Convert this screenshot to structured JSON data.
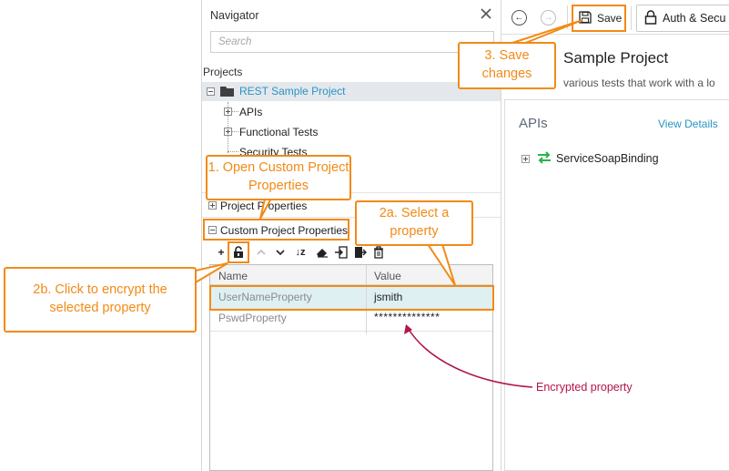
{
  "navigator": {
    "title": "Navigator",
    "search_placeholder": "Search",
    "projects_label": "Projects",
    "project_name": "REST Sample Project",
    "tree_items": [
      "APIs",
      "Functional Tests",
      "Security Tests"
    ],
    "project_properties_label": "Project Properties",
    "custom_properties_label": "Custom Project Properties"
  },
  "properties_table": {
    "columns": [
      "Name",
      "Value"
    ],
    "rows": [
      {
        "name": "UserNameProperty",
        "value": "jsmith"
      },
      {
        "name": "PswdProperty",
        "value": "**************"
      }
    ]
  },
  "toolbar": {
    "icons": [
      "add-icon",
      "encrypt-lock-icon",
      "move-up-icon",
      "move-down-icon",
      "sort-icon",
      "clear-icon",
      "import-icon",
      "export-icon",
      "delete-icon"
    ]
  },
  "right_panel": {
    "save_label": "Save",
    "auth_label": "Auth & Secu",
    "page_title": "Sample Project",
    "description": "various tests that work with a lo",
    "apis_title": "APIs",
    "view_details": "View Details",
    "service_name": "ServiceSoapBinding"
  },
  "callouts": {
    "open_custom": "1. Open Custom Project Properties",
    "select_property": "2a. Select a property",
    "encrypt": "2b. Click to encrypt the selected property",
    "save": "3. Save changes",
    "encrypted_note": "Encrypted property"
  },
  "colors": {
    "accent_orange": "#f28a16",
    "link_blue": "#2a94c2",
    "note_red": "#b3154d",
    "selection": "#dff0f3",
    "service_green": "#2bb24c"
  }
}
